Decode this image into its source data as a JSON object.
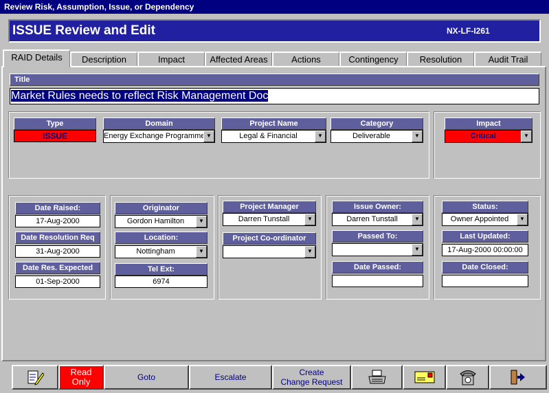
{
  "window": {
    "title": "Review Risk,  Assumption, Issue, or Dependency"
  },
  "header": {
    "title": "ISSUE Review and Edit",
    "code": "NX-LF-I261"
  },
  "tabs": [
    "RAID Details",
    "Description",
    "Impact",
    "Affected Areas",
    "Actions",
    "Contingency",
    "Resolution",
    "Audit Trail"
  ],
  "title_section": {
    "label": "Title",
    "value": "Market Rules needs to reflect Risk Management Doc"
  },
  "classification": {
    "type": {
      "label": "Type",
      "value": "ISSUE"
    },
    "domain": {
      "label": "Domain",
      "value": "Energy Exchange Programme"
    },
    "project_name": {
      "label": "Project Name",
      "value": "Legal & Financial"
    },
    "category": {
      "label": "Category",
      "value": "Deliverable"
    },
    "impact": {
      "label": "Impact",
      "value": "Critical"
    }
  },
  "dates": {
    "raised": {
      "label": "Date Raised:",
      "value": "17-Aug-2000"
    },
    "resolution_req": {
      "label": "Date Resolution Req",
      "value": "31-Aug-2000"
    },
    "res_expected": {
      "label": "Date Res. Expected",
      "value": "01-Sep-2000"
    }
  },
  "origin": {
    "originator": {
      "label": "Originator",
      "value": "Gordon Hamilton"
    },
    "location": {
      "label": "Location:",
      "value": "Nottingham"
    },
    "tel_ext": {
      "label": "Tel Ext:",
      "value": "6974"
    }
  },
  "project": {
    "manager": {
      "label": "Project  Manager",
      "value": "Darren Tunstall"
    },
    "coordinator": {
      "label": "Project Co-ordinator",
      "value": ""
    }
  },
  "ownership": {
    "owner": {
      "label": "Issue Owner:",
      "value": "Darren Tunstall"
    },
    "passed_to": {
      "label": "Passed To:",
      "value": ""
    },
    "date_passed": {
      "label": "Date Passed:",
      "value": ""
    }
  },
  "status": {
    "status": {
      "label": "Status:",
      "value": "Owner Appointed"
    },
    "last_updated": {
      "label": "Last Updated:",
      "value": "17-Aug-2000  00:00:00"
    },
    "date_closed": {
      "label": "Date Closed:",
      "value": ""
    }
  },
  "toolbar": {
    "read_only": "Read\nOnly",
    "goto": "Goto",
    "escalate": "Escalate",
    "create_cr": "Create\nChange Request"
  },
  "colors": {
    "type_bg": "#ff0000",
    "impact_bg": "#ff0000",
    "impact_text": "#000080",
    "label_bg": "#5f5f9e",
    "header_bg": "#2020a0"
  }
}
